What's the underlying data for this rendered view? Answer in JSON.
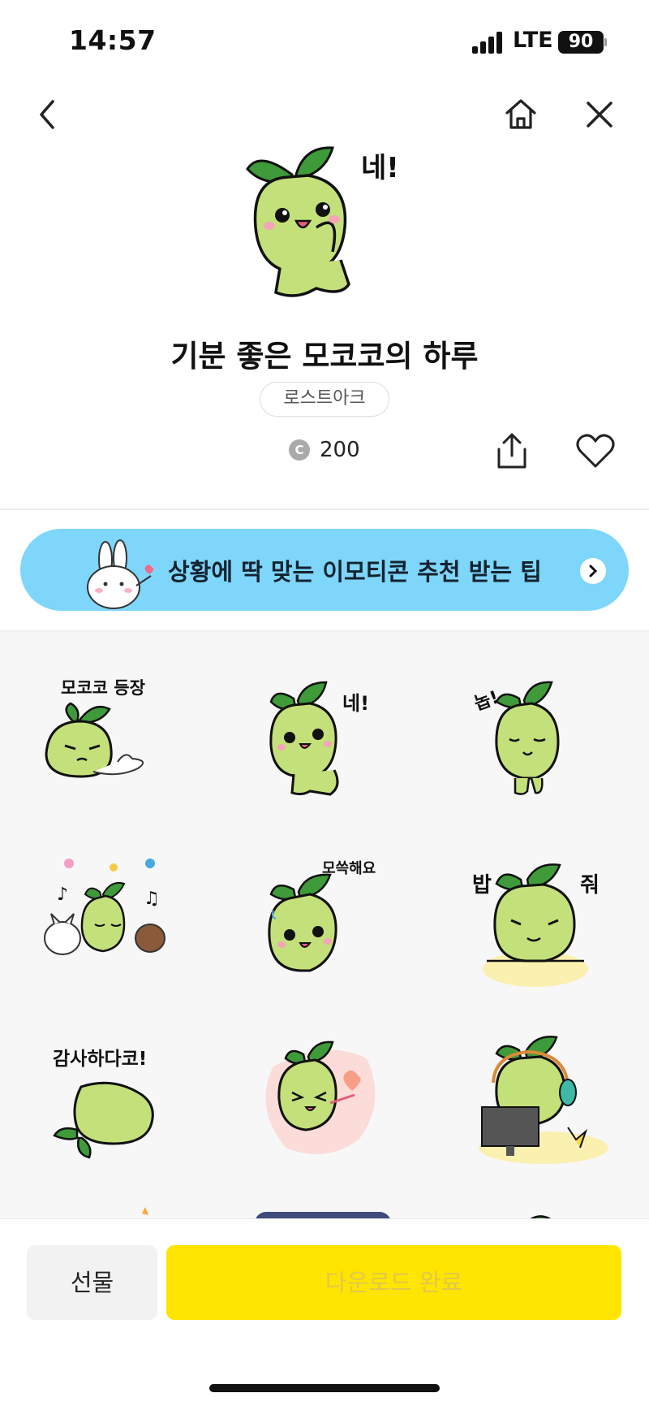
{
  "status_bar": {
    "time": "14:57",
    "network": "LTE",
    "battery": "90"
  },
  "nav": {
    "back_icon": "chevron-left-icon",
    "home_icon": "home-icon",
    "close_icon": "close-icon"
  },
  "hero": {
    "caption": "네!"
  },
  "product": {
    "title": "기분 좋은 모코코의 하루",
    "author": "로스트아크",
    "price": "200",
    "coin_symbol": "C"
  },
  "banner": {
    "text": "상황에 딱 맞는 이모티콘 추천 받는 팁"
  },
  "stickers": [
    {
      "caption": "모코코 등장"
    },
    {
      "caption": "네!"
    },
    {
      "caption": "놉!"
    },
    {
      "caption": ""
    },
    {
      "caption": "모쓱해요"
    },
    {
      "caption_left": "밥",
      "caption_right": "줘"
    },
    {
      "caption": "감사하다코!"
    },
    {
      "caption": ""
    },
    {
      "caption": ""
    }
  ],
  "bottom": {
    "gift_label": "선물",
    "download_label": "다운로드 완료"
  },
  "colors": {
    "accent_yellow": "#fee500",
    "banner_blue": "#7fd6fb",
    "mokoko_green": "#c3e07a",
    "leaf_green": "#3f9a3a"
  }
}
